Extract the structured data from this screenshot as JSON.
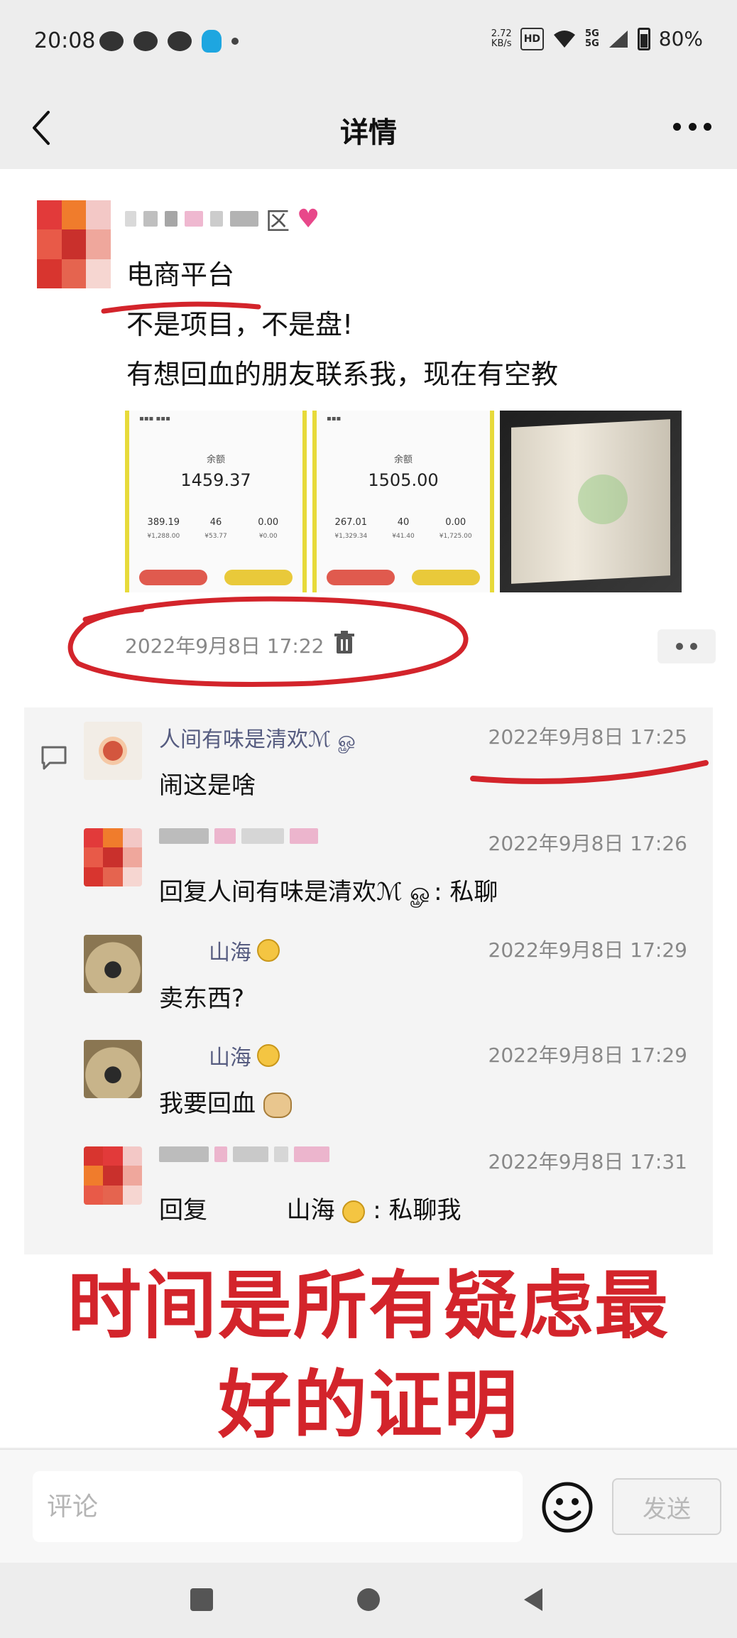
{
  "status_bar": {
    "time": "20:08",
    "net_speed": "2.72\nKB/s",
    "hd": "HD",
    "signal_1": "5G",
    "signal_2": "5G",
    "battery": "80%"
  },
  "nav": {
    "title": "详情"
  },
  "post": {
    "author_suffix": "区",
    "line1": "电商平台",
    "line2": "不是项目，不是盘!",
    "line3": "有想回血的朋友联系我，现在有空教",
    "images": [
      {
        "label": "余额",
        "amount": "1459.37",
        "stats": [
          "389.19",
          "46",
          "0.00"
        ],
        "subs": [
          "¥1,288.00",
          "¥53.77",
          "¥0.00"
        ]
      },
      {
        "label": "余额",
        "amount": "1505.00",
        "stats": [
          "267.01",
          "40",
          "0.00"
        ],
        "subs": [
          "¥1,329.34",
          "¥41.40",
          "¥1,725.00"
        ]
      }
    ],
    "timestamp": "2022年9月8日 17:22"
  },
  "comments": [
    {
      "name": "人间有味是清欢ℳ ௐ",
      "time": "2022年9月8日 17:25",
      "text": "闹这是啥"
    },
    {
      "name": "",
      "time": "2022年9月8日 17:26",
      "text": "回复人间有味是清欢ℳ ௐ: 私聊"
    },
    {
      "name": "山海",
      "time": "2022年9月8日 17:29",
      "text": "卖东西?"
    },
    {
      "name": "山海",
      "time": "2022年9月8日 17:29",
      "text": "我要回血"
    },
    {
      "name": "",
      "time": "2022年9月8日 17:31",
      "text_prefix": "回复",
      "text_name": "山海",
      "text_suffix": ": 私聊我"
    }
  ],
  "banner": {
    "line1": "时间是所有疑虑最",
    "line2": "好的证明"
  },
  "input_bar": {
    "placeholder": "评论",
    "send_label": "发送"
  },
  "colors": {
    "accent_red": "#d3242b",
    "name_blue": "#565c80",
    "card_yellow": "#e7da3a"
  }
}
